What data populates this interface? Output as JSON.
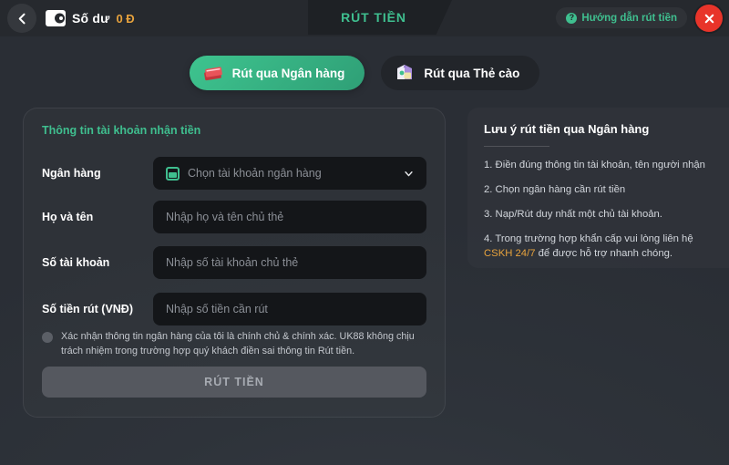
{
  "topbar": {
    "back_icon": "chevron-left-icon",
    "wallet_icon": "wallet-icon",
    "balance_label": "Số dư",
    "balance_value": "0 Đ",
    "active_tab": "RÚT TIỀN",
    "guide_icon": "question-circle-icon",
    "guide_label": "Hướng dẫn rút tiền",
    "close_icon": "close-icon",
    "accent_green": "#3fbf8f",
    "accent_gold": "#e8a33d",
    "close_red": "#e8342a"
  },
  "methods": [
    {
      "label": "Rút qua Ngân hàng",
      "icon": "bank-cards-icon",
      "active": true
    },
    {
      "label": "Rút qua Thẻ cào",
      "icon": "scratch-card-icon",
      "active": false
    }
  ],
  "form": {
    "title": "Thông tin tài khoản nhận tiền",
    "fields": [
      {
        "label": "Ngân hàng",
        "type": "select",
        "icon": "bank-icon",
        "placeholder": "Chọn tài khoản ngân hàng",
        "value": "",
        "chevron": "chevron-down-icon"
      },
      {
        "label": "Họ và tên",
        "type": "text",
        "placeholder": "Nhập họ và tên chủ thẻ",
        "value": ""
      },
      {
        "label": "Số tài khoản",
        "type": "text",
        "placeholder": "Nhập số tài khoản chủ thẻ",
        "value": ""
      },
      {
        "label": "Số tiền rút (VNĐ)",
        "type": "text",
        "placeholder": "Nhập số tiền cần rút",
        "value": ""
      }
    ],
    "consent_text": "Xác nhận thông tin ngân hàng của tôi là chính chủ & chính xác. UK88 không chịu trách nhiệm trong trường hợp quý khách điền sai thông tin Rút tiền.",
    "consent_checked": false,
    "submit_label": "RÚT TIỀN",
    "submit_enabled": false
  },
  "notes": {
    "title": "Lưu ý rút tiền qua Ngân hàng",
    "items": [
      {
        "pre": "1. Điền đúng thông tin tài khoản, tên người nhận",
        "hl": "",
        "post": ""
      },
      {
        "pre": "2. Chọn ngân hàng cần rút tiền",
        "hl": "",
        "post": ""
      },
      {
        "pre": "3. Nạp/Rút duy nhất một chủ tài khoản.",
        "hl": "",
        "post": ""
      },
      {
        "pre": "4. Trong trường hợp khẩn cấp vui lòng liên hệ ",
        "hl": "CSKH 24/7",
        "post": " để được hỗ trợ nhanh chóng."
      }
    ]
  }
}
